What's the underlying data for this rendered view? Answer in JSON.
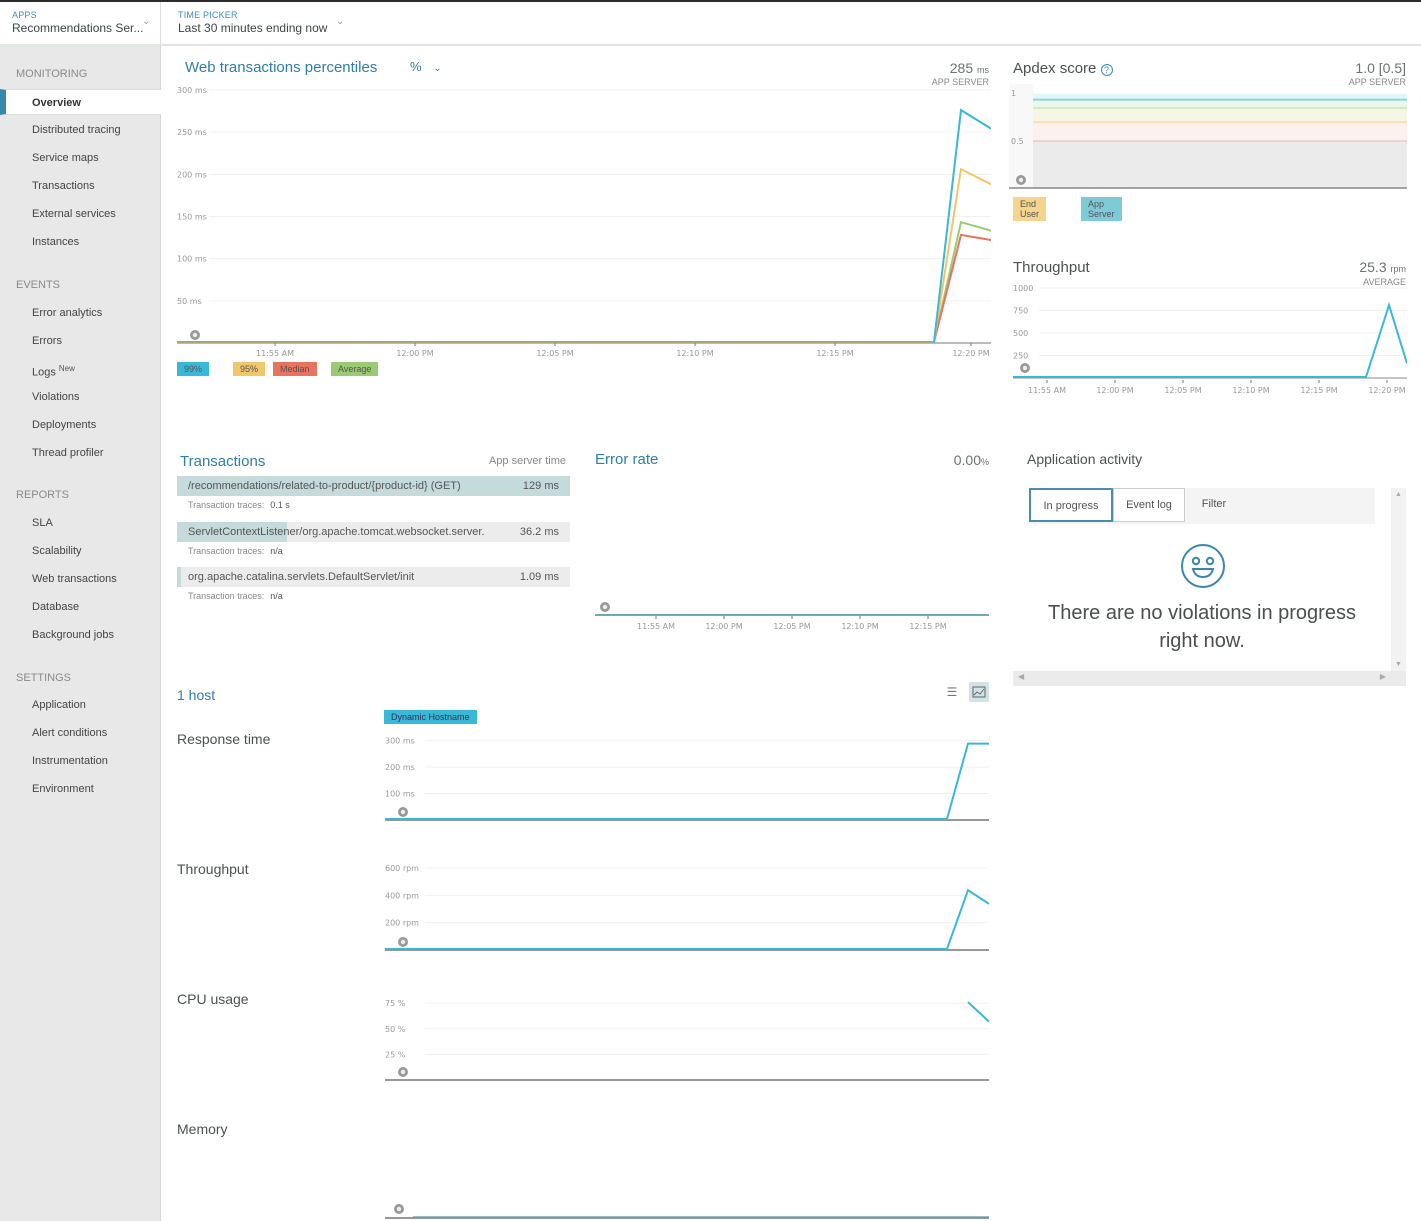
{
  "topbar": {
    "apps": {
      "label": "APPS",
      "value": "Recommendations Ser..."
    },
    "time_picker": {
      "label": "TIME PICKER",
      "value": "Last 30 minutes ending now"
    }
  },
  "sidebar": {
    "sections": [
      {
        "title": "MONITORING",
        "items": [
          {
            "label": "Overview",
            "active": true
          },
          {
            "label": "Distributed tracing"
          },
          {
            "label": "Service maps"
          },
          {
            "label": "Transactions"
          },
          {
            "label": "External services"
          },
          {
            "label": "Instances"
          }
        ]
      },
      {
        "title": "EVENTS",
        "items": [
          {
            "label": "Error analytics"
          },
          {
            "label": "Errors"
          },
          {
            "label": "Logs",
            "badge": "New"
          },
          {
            "label": "Violations"
          },
          {
            "label": "Deployments"
          },
          {
            "label": "Thread profiler"
          }
        ]
      },
      {
        "title": "REPORTS",
        "items": [
          {
            "label": "SLA"
          },
          {
            "label": "Scalability"
          },
          {
            "label": "Web transactions"
          },
          {
            "label": "Database"
          },
          {
            "label": "Background jobs"
          }
        ]
      },
      {
        "title": "SETTINGS",
        "items": [
          {
            "label": "Application"
          },
          {
            "label": "Alert conditions"
          },
          {
            "label": "Instrumentation"
          },
          {
            "label": "Environment"
          }
        ]
      }
    ]
  },
  "web_tx": {
    "title": "Web transactions percentiles",
    "selector": "%",
    "metric_value": "285",
    "metric_unit": "ms",
    "metric_sub": "APP SERVER"
  },
  "apdex": {
    "title": "Apdex score",
    "metric_value": "1.0 [0.5]",
    "metric_sub": "APP SERVER",
    "legend": [
      {
        "label": "End User",
        "color": "#f5d48e"
      },
      {
        "label": "App Server",
        "color": "#7fcad8"
      }
    ]
  },
  "throughput": {
    "title": "Throughput",
    "metric_value": "25.3",
    "metric_unit": "rpm",
    "metric_sub": "AVERAGE"
  },
  "transactions": {
    "title": "Transactions",
    "column_header": "App server time",
    "trace_label": "Transaction traces:",
    "rows": [
      {
        "name": "/recommendations/related-to-product/{product-id} (GET)",
        "value": "129 ms",
        "fraction": 1.0,
        "traces": "0.1 s"
      },
      {
        "name": "ServletContextListener/org.apache.tomcat.websocket.server.",
        "value": "36.2 ms",
        "fraction": 0.28,
        "traces": "n/a"
      },
      {
        "name": "org.apache.catalina.servlets.DefaultServlet/init",
        "value": "1.09 ms",
        "fraction": 0.01,
        "traces": "n/a"
      }
    ]
  },
  "error_rate": {
    "title": "Error rate",
    "metric_value": "0.00",
    "metric_unit": "%"
  },
  "activity": {
    "title": "Application activity",
    "tabs": [
      {
        "label": "In progress",
        "active": true
      },
      {
        "label": "Event log"
      },
      {
        "label": "Filter"
      }
    ],
    "empty_message": "There are no violations in progress right now."
  },
  "hosts": {
    "title": "1 host",
    "legend": "Dynamic Hostname",
    "chart_labels": [
      "Response time",
      "Throughput",
      "CPU usage",
      "Memory"
    ]
  },
  "chart_data": [
    {
      "id": "web_tx_percentiles",
      "type": "line",
      "title": "Web transactions percentiles",
      "x": [
        "11:52",
        "11:53",
        "11:54",
        "11:55",
        "11:56",
        "11:57",
        "11:58",
        "11:59",
        "12:00",
        "12:01",
        "12:02",
        "12:03",
        "12:04",
        "12:05",
        "12:06",
        "12:07",
        "12:08",
        "12:09",
        "12:10",
        "12:11",
        "12:12",
        "12:13",
        "12:14",
        "12:15",
        "12:16",
        "12:17",
        "12:18",
        "12:19",
        "12:20",
        "12:21"
      ],
      "xticks": [
        "11:55 AM",
        "12:00 PM",
        "12:05 PM",
        "12:10 PM",
        "12:15 PM",
        "12:20 PM"
      ],
      "ylim": [
        0,
        300
      ],
      "yticks": [
        "50 ms",
        "100 ms",
        "150 ms",
        "200 ms",
        "250 ms",
        "300 ms"
      ],
      "series": [
        {
          "name": "99%",
          "color": "#3ab8d8",
          "tail": [
            0,
            275,
            253
          ]
        },
        {
          "name": "95%",
          "color": "#f0c76a",
          "tail": [
            0,
            205,
            187
          ]
        },
        {
          "name": "Median",
          "color": "#e8735f",
          "tail": [
            0,
            127,
            121
          ]
        },
        {
          "name": "Average",
          "color": "#9acb74",
          "tail": [
            0,
            142,
            132
          ]
        }
      ]
    },
    {
      "id": "apdex",
      "type": "line",
      "title": "Apdex score",
      "ylim": [
        0,
        1
      ],
      "yticks": [
        "0.5",
        "1"
      ],
      "bands": [
        0.5,
        0.7,
        0.85,
        0.94,
        1.0
      ],
      "series": [
        {
          "name": "App Server",
          "value": 1.0
        }
      ]
    },
    {
      "id": "throughput",
      "type": "line",
      "title": "Throughput",
      "xticks": [
        "11:55 AM",
        "12:00 PM",
        "12:05 PM",
        "12:10 PM",
        "12:15 PM",
        "12:20 PM"
      ],
      "ylim": [
        0,
        1000
      ],
      "yticks": [
        "250",
        "500",
        "750",
        "1000"
      ],
      "series": [
        {
          "name": "Throughput",
          "color": "#3ab8d8",
          "tail": [
            0,
            450,
            800,
            150
          ]
        }
      ]
    },
    {
      "id": "error_rate",
      "type": "line",
      "title": "Error rate",
      "xticks": [
        "11:55 AM",
        "12:00 PM",
        "12:05 PM",
        "12:10 PM",
        "12:15 PM"
      ],
      "series": [
        {
          "name": "Error rate",
          "value": 0
        }
      ]
    },
    {
      "id": "host_response",
      "type": "line",
      "title": "Response time",
      "ylim": [
        0,
        300
      ],
      "yticks": [
        "100 ms",
        "200 ms",
        "300 ms"
      ],
      "series": [
        {
          "name": "Dynamic Hostname",
          "color": "#3ab8d8",
          "tail": [
            0,
            285,
            285
          ]
        }
      ]
    },
    {
      "id": "host_throughput",
      "type": "line",
      "title": "Throughput",
      "ylim": [
        0,
        600
      ],
      "yticks": [
        "200 rpm",
        "400 rpm",
        "600 rpm"
      ],
      "series": [
        {
          "name": "Dynamic Hostname",
          "color": "#3ab8d8",
          "tail": [
            0,
            430,
            330
          ]
        }
      ]
    },
    {
      "id": "host_cpu",
      "type": "line",
      "title": "CPU usage",
      "ylim": [
        0,
        80
      ],
      "yticks": [
        "25 %",
        "50 %",
        "75 %"
      ],
      "series": [
        {
          "name": "Dynamic Hostname",
          "color": "#3ab8d8",
          "tail": [
            75,
            56
          ]
        }
      ]
    },
    {
      "id": "host_memory",
      "type": "line",
      "title": "Memory",
      "series": [
        {
          "name": "Dynamic Hostname",
          "color": "#3ab8d8",
          "value": 0
        }
      ]
    }
  ]
}
